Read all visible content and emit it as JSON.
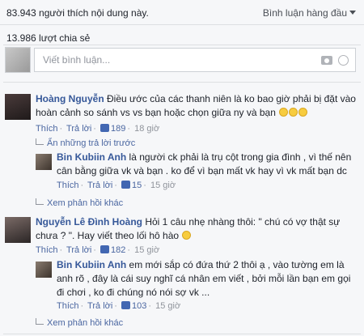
{
  "header": {
    "likes_count": "83.943",
    "likes_text": "người thích nội dung này.",
    "sort_label": "Bình luận hàng đầu",
    "shares_text": "13.986 lượt chia sẻ"
  },
  "composer": {
    "placeholder": "Viết bình luận..."
  },
  "comments": [
    {
      "author": "Hoàng Nguyễn",
      "text": "Điều ước của các thanh niên là ko bao giờ phải bị đặt vào hoàn cảnh so sánh vs vs bạn hoặc chọn giữa ny và bạn",
      "actions": {
        "like": "Thích",
        "reply": "Trả lời",
        "likes": "189",
        "time": "18 giờ"
      },
      "hide_replies": "Ẩn những trả lời trước",
      "reply": {
        "author": "Bin Kubiin Anh",
        "text": "là người ck phải là trụ cột trong gia đình , vì thế nên cân bằng giữa vk và bạn . ko để vì bạn mất vk hay vì vk mất bạn dc",
        "actions": {
          "like": "Thích",
          "reply": "Trả lời",
          "likes": "15",
          "time": "15 giờ"
        }
      },
      "more_replies": "Xem phản hồi khác"
    },
    {
      "author": "Nguyễn Lê Đình Hoàng",
      "text": "Hỏi 1 câu nhẹ nhàng thôi: \" chú có vợ thật sự chưa ? \". Hay viết theo lối hô hào",
      "actions": {
        "like": "Thích",
        "reply": "Trả lời",
        "likes": "182",
        "time": "15 giờ"
      },
      "reply": {
        "author": "Bin Kubiin Anh",
        "text": "em mới sắp có đứa thứ 2 thôi ạ , vào tường em là anh rõ , đây là cái suy nghĩ cá nhân em viết , bởi mỗi lần bạn em gọi đi chơi , ko đi chúng nó nói sợ vk ...",
        "actions": {
          "like": "Thích",
          "reply": "Trả lời",
          "likes": "103",
          "time": "15 giờ"
        }
      },
      "more_replies": "Xem phản hồi khác"
    }
  ],
  "colors": {
    "link": "#365899",
    "meta": "#90949c",
    "like_blue": "#4267b2"
  }
}
